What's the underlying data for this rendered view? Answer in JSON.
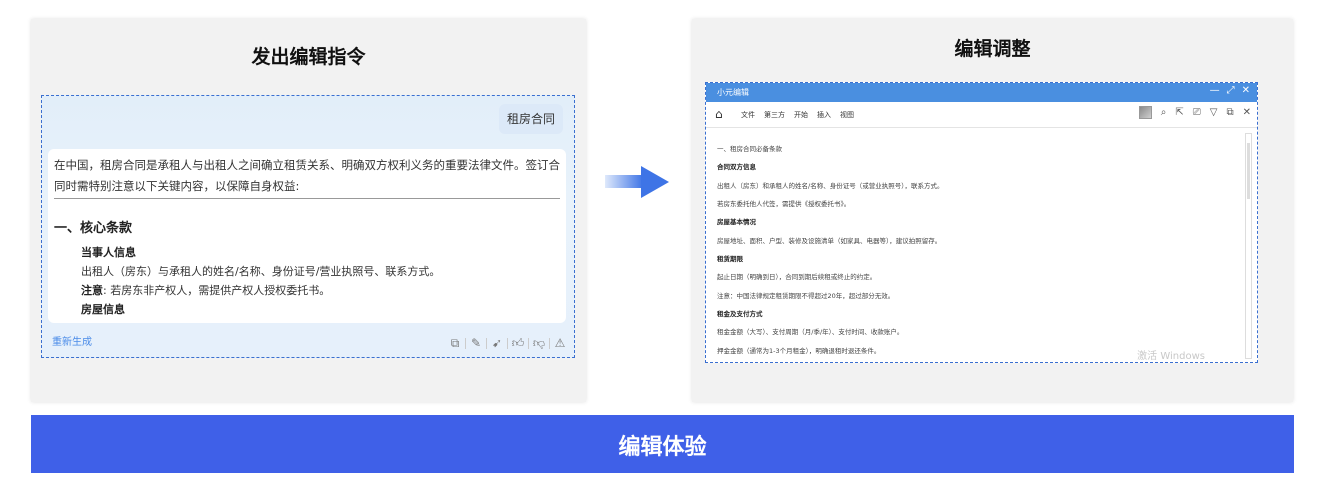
{
  "left_panel": {
    "title": "发出编辑指令",
    "chip": "租房合同",
    "intro": "在中国，租房合同是承租人与出租人之间确立租赁关系、明确双方权利义务的重要法律文件。签订合同时需特别注意以下关键内容，以保障自身权益:",
    "section_heading": "一、核心条款",
    "party_heading": "当事人信息",
    "party_line": "出租人（房东）与承租人的姓名/名称、身份证号/营业执照号、联系方式。",
    "note_label": "注意",
    "note_text": ": 若房东非产权人，需提供产权人授权委托书。",
    "house_heading": "房屋信息",
    "regen": "重新生成",
    "action_icons": [
      "copy-icon",
      "edit-icon",
      "send-icon",
      "thumbs-up-icon",
      "thumbs-down-icon",
      "warning-icon"
    ]
  },
  "right_panel": {
    "title": "编辑调整",
    "app_title": "小元编辑",
    "menu": [
      "文件",
      "第三方",
      "开始",
      "插入",
      "视图"
    ],
    "doc_lines": [
      {
        "text": "一、租房合同必备条款",
        "bold": false
      },
      {
        "text": "合同双方信息",
        "bold": true
      },
      {
        "text": "出租人（房东）和承租人的姓名/名称、身份证号（或营业执照号），联系方式。",
        "bold": false
      },
      {
        "text": "若房东委托他人代签，需提供《授权委托书》。",
        "bold": false
      },
      {
        "text": "房屋基本情况",
        "bold": true
      },
      {
        "text": "房屋地址、面积、户型、装修及设施清单（如家具、电器等），建议拍照留存。",
        "bold": false
      },
      {
        "text": "租赁期限",
        "bold": true
      },
      {
        "text": "起止日期（明确到日），合同到期后续租或终止的约定。",
        "bold": false
      },
      {
        "text": "注意：中国法律规定租赁期限不得超过20年，超过部分无效。",
        "bold": false
      },
      {
        "text": "租金及支付方式",
        "bold": true
      },
      {
        "text": "租金金额（大写）、支付周期（月/季/年）、支付时间、收款账户。",
        "bold": false
      },
      {
        "text": "押金金额（通常为1-3个月租金），明确退租时退还条件。",
        "bold": false
      }
    ],
    "watermark": "激活 Windows"
  },
  "banner": {
    "text": "编辑体验"
  },
  "colors": {
    "banner": "#3f60e8",
    "titlebar": "#4a8fe0",
    "dashed_border": "#3a6fd0",
    "link": "#4a8be8"
  }
}
